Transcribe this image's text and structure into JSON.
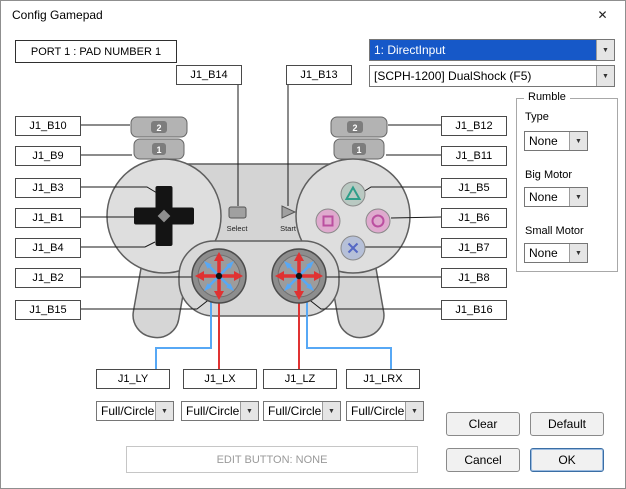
{
  "window": {
    "title": "Config Gamepad"
  },
  "icons": {
    "close": "✕",
    "dropdown_arrow": "▼"
  },
  "header": {
    "port_label": "PORT 1 : PAD NUMBER 1",
    "api_value": "1: DirectInput",
    "device_value": "[SCPH-1200] DualShock (F5)"
  },
  "pad_labels": {
    "top": [
      "J1_B14",
      "J1_B13"
    ],
    "left": [
      "J1_B10",
      "J1_B9",
      "J1_B3",
      "J1_B1",
      "J1_B4",
      "J1_B2",
      "J1_B15"
    ],
    "right": [
      "J1_B12",
      "J1_B11",
      "J1_B5",
      "J1_B6",
      "J1_B7",
      "J1_B8",
      "J1_B16"
    ]
  },
  "controller": {
    "select_label": "Select",
    "start_label": "Start",
    "shoulder_upper": "2",
    "shoulder_lower": "1"
  },
  "rumble": {
    "title": "Rumble",
    "type_label": "Type",
    "type_value": "None",
    "big_motor_label": "Big Motor",
    "big_motor_value": "None",
    "small_motor_label": "Small Motor",
    "small_motor_value": "None"
  },
  "axes": {
    "labels": [
      "J1_LY",
      "J1_LX",
      "J1_LZ",
      "J1_LRX"
    ],
    "modes": [
      "Full/Circle",
      "Full/Circle",
      "Full/Circle",
      "Full/Circle"
    ]
  },
  "actions": {
    "clear": "Clear",
    "default": "Default",
    "cancel": "Cancel",
    "ok": "OK"
  },
  "status": {
    "edit_button": "EDIT BUTTON: NONE"
  },
  "colors": {
    "selection": "#1658c8",
    "axis_x": "#e03232",
    "axis_diagonal": "#57a8f5"
  }
}
